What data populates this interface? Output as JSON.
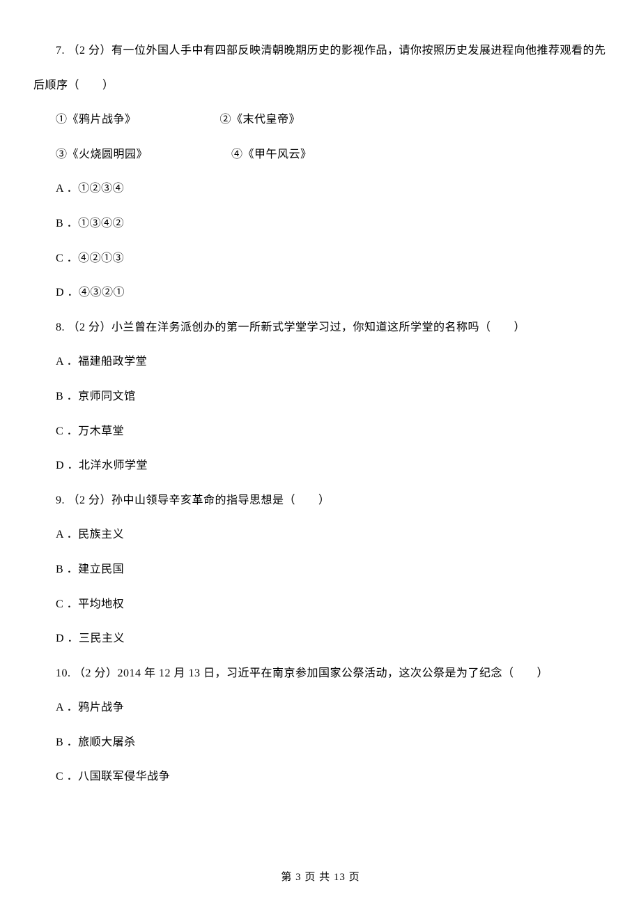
{
  "q7": {
    "text_line1": "7. （2 分）有一位外国人手中有四部反映清朝晚期历史的影视作品，请你按照历史发展进程向他推荐观看的先",
    "text_line2": "后顺序（　　）",
    "movies": {
      "m1": "①《鸦片战争》",
      "m2": "②《末代皇帝》",
      "m3": "③《火烧圆明园》",
      "m4": "④《甲午风云》"
    },
    "options": {
      "A": "A ．①②③④",
      "B": "B ．①③④②",
      "C": "C ．④②①③",
      "D": "D ．④③②①"
    }
  },
  "q8": {
    "text": "8. （2 分）小兰曾在洋务派创办的第一所新式学堂学习过，你知道这所学堂的名称吗（　　）",
    "options": {
      "A": "A ．福建船政学堂",
      "B": "B ．京师同文馆",
      "C": "C ．万木草堂",
      "D": "D ．北洋水师学堂"
    }
  },
  "q9": {
    "text": "9. （2 分）孙中山领导辛亥革命的指导思想是（　　）",
    "options": {
      "A": "A ．民族主义",
      "B": "B ．建立民国",
      "C": "C ．平均地权",
      "D": "D ．三民主义"
    }
  },
  "q10": {
    "text": "10. （2 分）2014 年 12 月 13 日，习近平在南京参加国家公祭活动，这次公祭是为了纪念（　　）",
    "options": {
      "A": "A ．鸦片战争",
      "B": "B ．旅顺大屠杀",
      "C": "C ．八国联军侵华战争"
    }
  },
  "footer": "第 3 页 共 13 页"
}
